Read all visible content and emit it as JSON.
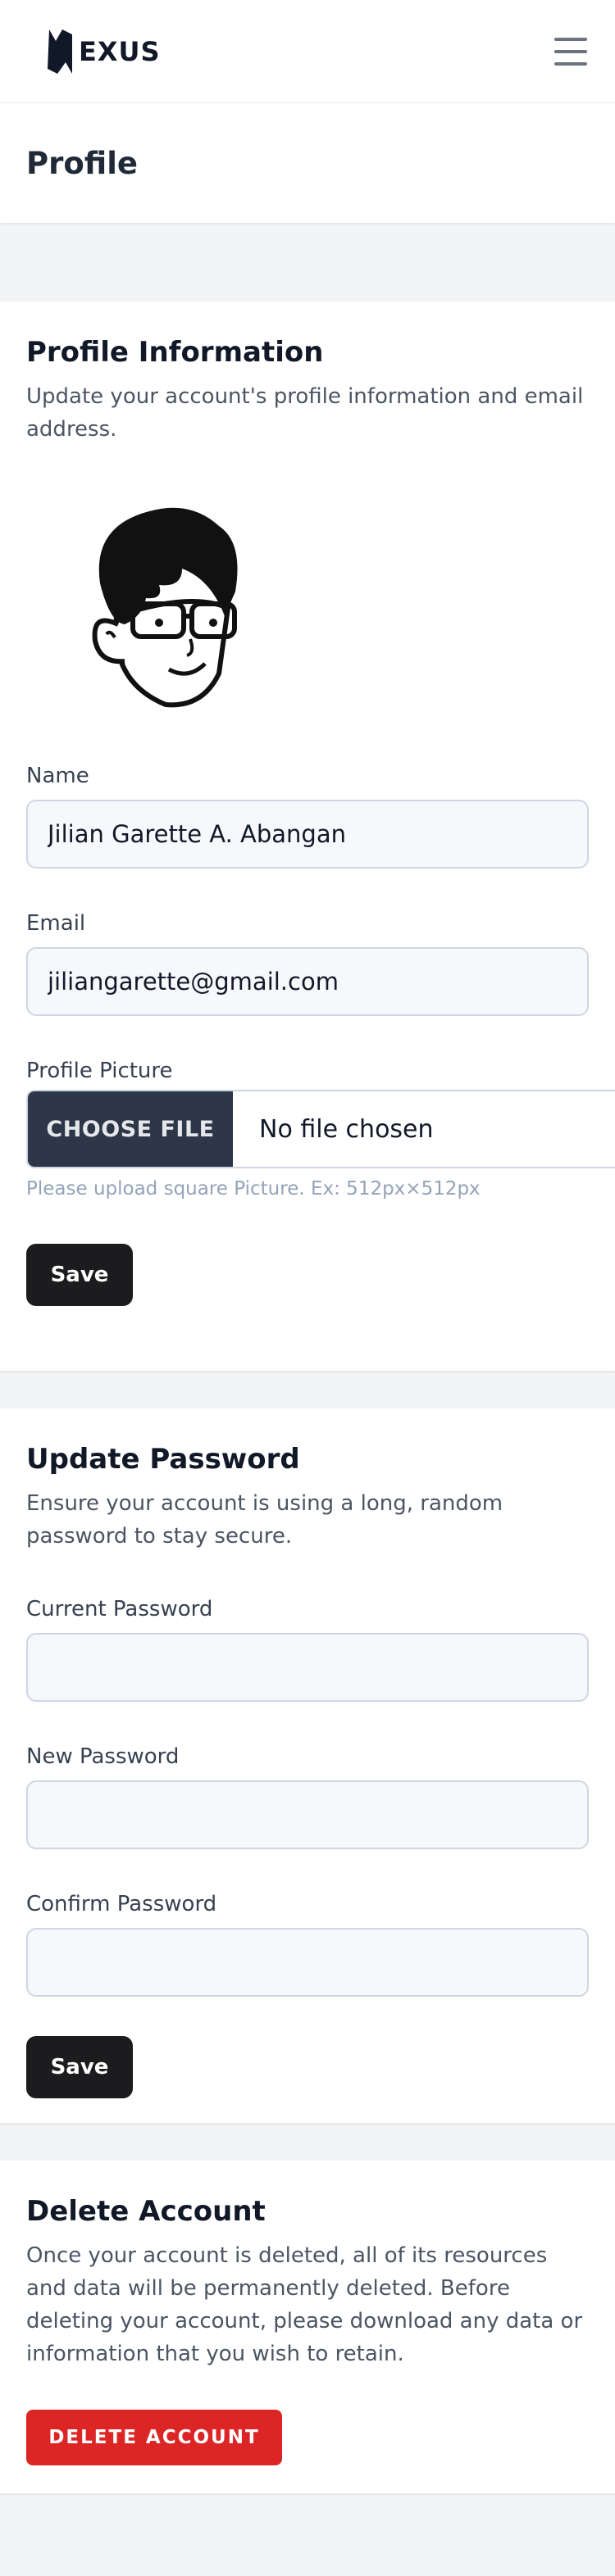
{
  "app": {
    "logo_text": "EXUS"
  },
  "header": {
    "title": "Profile"
  },
  "profile_info": {
    "title": "Profile Information",
    "description": "Update your account's profile information and email address.",
    "name_label": "Name",
    "name_value": "Jilian Garette A. Abangan",
    "email_label": "Email",
    "email_value": "jiliangarette@gmail.com",
    "picture_label": "Profile Picture",
    "choose_file_label": "CHOOSE FILE",
    "file_status": "No file chosen",
    "hint": "Please upload square Picture. Ex: 512px×512px",
    "save_label": "Save"
  },
  "update_password": {
    "title": "Update Password",
    "description": "Ensure your account is using a long, random password to stay secure.",
    "current_label": "Current Password",
    "current_value": "",
    "new_label": "New Password",
    "new_value": "",
    "confirm_label": "Confirm Password",
    "confirm_value": "",
    "save_label": "Save"
  },
  "delete_account": {
    "title": "Delete Account",
    "description": "Once your account is deleted, all of its resources and data will be permanently deleted. Before deleting your account, please download any data or information that you wish to retain.",
    "button_label": "DELETE ACCOUNT"
  },
  "colors": {
    "danger": "#dc2626",
    "primary_button": "#1c1c1e",
    "file_button": "#2d3748",
    "page_background": "#f3f4f6"
  },
  "icons": {
    "logo": "exus-logo-icon",
    "menu": "hamburger-menu-icon",
    "avatar": "cartoon-avatar-icon"
  }
}
